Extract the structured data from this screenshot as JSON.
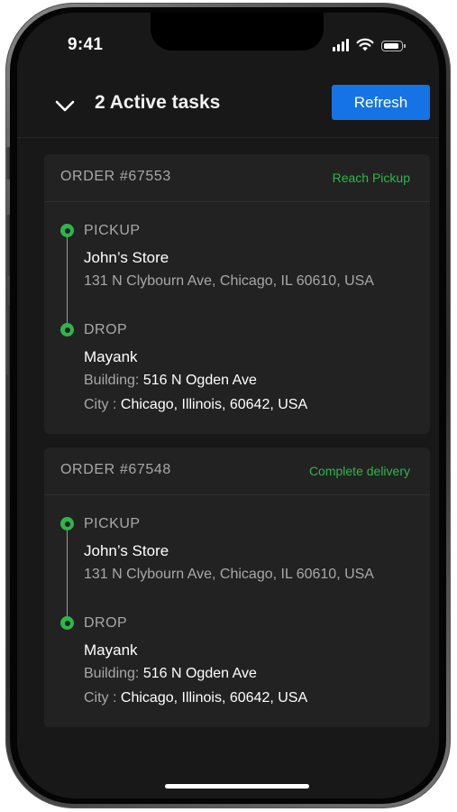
{
  "status_bar": {
    "time": "9:41"
  },
  "header": {
    "title": "2 Active tasks",
    "refresh_label": "Refresh"
  },
  "orders": [
    {
      "order_id": "ORDER #67553",
      "status": "Reach Pickup",
      "pickup": {
        "label": "PICKUP",
        "name": "John’s Store",
        "address": "131 N Clybourn Ave, Chicago, IL 60610, USA"
      },
      "drop": {
        "label": "DROP",
        "name": "Mayank",
        "building_label": "Building:",
        "building_value": "516 N Ogden Ave",
        "city_label": "City :",
        "city_value": "Chicago, Illinois,  60642, USA"
      }
    },
    {
      "order_id": "ORDER #67548",
      "status": "Complete delivery",
      "pickup": {
        "label": "PICKUP",
        "name": "John’s Store",
        "address": "131 N Clybourn Ave, Chicago, IL 60610, USA"
      },
      "drop": {
        "label": "DROP",
        "name": "Mayank",
        "building_label": "Building:",
        "building_value": "516 N Ogden Ave",
        "city_label": "City :",
        "city_value": "Chicago, Illinois,  60642, USA"
      }
    }
  ],
  "colors": {
    "accent": "#1673E6",
    "status_green": "#2FB54C",
    "background": "#181818",
    "card": "#222222"
  },
  "icons": {
    "collapse": "chevron-down-icon",
    "signal": "cellular-signal-icon",
    "wifi": "wifi-icon",
    "battery": "battery-icon"
  }
}
